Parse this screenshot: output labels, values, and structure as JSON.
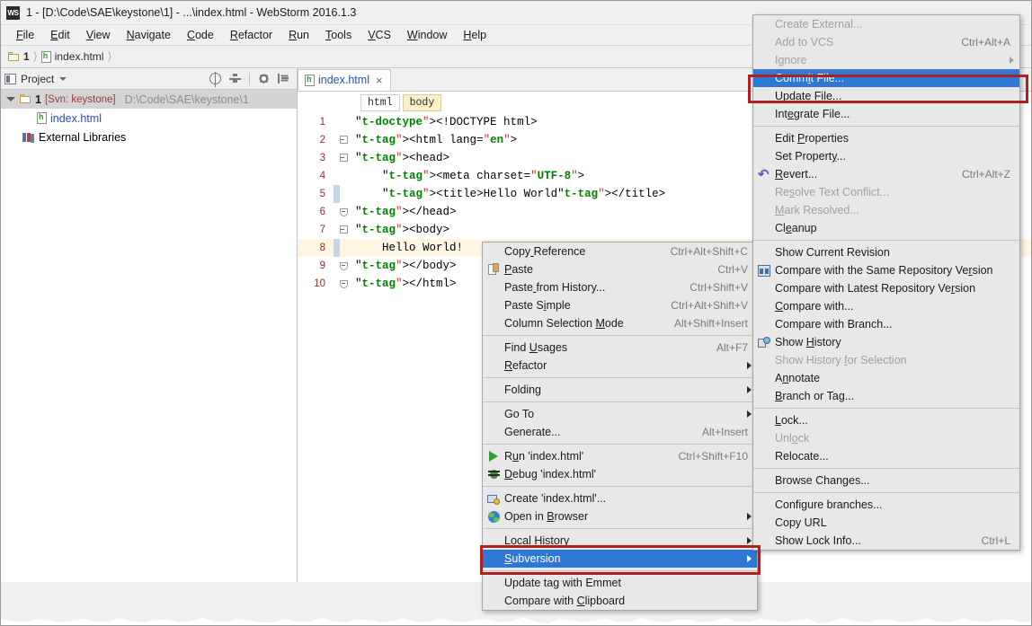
{
  "window": {
    "logo": "WS",
    "title": "1 - [D:\\Code\\SAE\\keystone\\1] - ...\\index.html - WebStorm 2016.1.3"
  },
  "menubar": [
    {
      "label": "File"
    },
    {
      "label": "Edit"
    },
    {
      "label": "View"
    },
    {
      "label": "Navigate"
    },
    {
      "label": "Code"
    },
    {
      "label": "Refactor"
    },
    {
      "label": "Run"
    },
    {
      "label": "Tools"
    },
    {
      "label": "VCS"
    },
    {
      "label": "Window"
    },
    {
      "label": "Help"
    }
  ],
  "breadcrumb": {
    "items": [
      "1",
      "index.html"
    ]
  },
  "project_panel": {
    "title": "Project",
    "tree": [
      {
        "name": "1",
        "svn": "[Svn: keystone]",
        "path": "D:\\Code\\SAE\\keystone\\1"
      },
      {
        "name": "index.html"
      },
      {
        "name": "External Libraries"
      }
    ]
  },
  "editor": {
    "tab": {
      "label": "index.html",
      "close": "×"
    },
    "breadcrumbs": [
      {
        "label": "html",
        "active": false
      },
      {
        "label": "body",
        "active": true
      }
    ],
    "lines": [
      {
        "n": "1",
        "text": "<!DOCTYPE html>"
      },
      {
        "n": "2",
        "text": "<html lang=\"en\">"
      },
      {
        "n": "3",
        "text": "<head>"
      },
      {
        "n": "4",
        "text": "    <meta charset=\"UTF-8\">"
      },
      {
        "n": "5",
        "text": "    <title>Hello World</title>"
      },
      {
        "n": "6",
        "text": "</head>"
      },
      {
        "n": "7",
        "text": "<body>"
      },
      {
        "n": "8",
        "text": "    Hello World!"
      },
      {
        "n": "9",
        "text": "</body>"
      },
      {
        "n": "10",
        "text": "</html>"
      }
    ]
  },
  "context_menu": {
    "items": [
      {
        "label": "Copy Reference",
        "key": "Ctrl+Alt+Shift+C",
        "icon": "",
        "mn": 4
      },
      {
        "label": "Paste",
        "key": "Ctrl+V",
        "icon": "paste-icon",
        "mn": 0
      },
      {
        "label": "Paste from History...",
        "key": "Ctrl+Shift+V",
        "icon": "",
        "mn": 5
      },
      {
        "label": "Paste Simple",
        "key": "Ctrl+Alt+Shift+V",
        "icon": "",
        "mn": 7
      },
      {
        "label": "Column Selection Mode",
        "key": "Alt+Shift+Insert",
        "icon": "",
        "mn": 17
      },
      {
        "sep": true
      },
      {
        "label": "Find Usages",
        "key": "Alt+F7",
        "icon": "",
        "mn": 5
      },
      {
        "label": "Refactor",
        "key": "",
        "icon": "",
        "arrow": true,
        "mn": 0
      },
      {
        "sep": true
      },
      {
        "label": "Folding",
        "key": "",
        "icon": "",
        "arrow": true,
        "mn": -1
      },
      {
        "sep": true
      },
      {
        "label": "Go To",
        "key": "",
        "icon": "",
        "arrow": true,
        "mn": -1
      },
      {
        "label": "Generate...",
        "key": "Alt+Insert",
        "icon": "",
        "mn": -1
      },
      {
        "sep": true
      },
      {
        "label": "Run 'index.html'",
        "key": "Ctrl+Shift+F10",
        "icon": "run-icon",
        "mn": 1
      },
      {
        "label": "Debug 'index.html'",
        "key": "",
        "icon": "debug-icon",
        "mn": 0
      },
      {
        "sep": true
      },
      {
        "label": "Create 'index.html'...",
        "key": "",
        "icon": "create-icon",
        "mn": -1
      },
      {
        "label": "Open in Browser",
        "key": "",
        "icon": "browser-icon",
        "arrow": true,
        "mn": 8
      },
      {
        "sep": true
      },
      {
        "label": "Local History",
        "key": "",
        "icon": "",
        "arrow": true,
        "mn": -1
      },
      {
        "label": "Subversion",
        "key": "",
        "icon": "",
        "arrow": true,
        "selected": true,
        "mn": 0
      },
      {
        "sep": true
      },
      {
        "label": "Update tag with Emmet",
        "key": "",
        "icon": "",
        "mn": -1
      },
      {
        "label": "Compare with Clipboard",
        "key": "",
        "icon": "",
        "mn": 13
      }
    ]
  },
  "subversion_menu": {
    "items": [
      {
        "label": "Create External...",
        "key": "",
        "disabled": true,
        "icon": "",
        "mn": -1
      },
      {
        "label": "Add to VCS",
        "key": "Ctrl+Alt+A",
        "disabled": true,
        "icon": "",
        "mn": -1
      },
      {
        "label": "Ignore",
        "key": "",
        "disabled": true,
        "icon": "",
        "arrow": true,
        "mn": -1
      },
      {
        "label": "Commit File...",
        "key": "",
        "selected": true,
        "icon": "",
        "mn": 4
      },
      {
        "label": "Update File...",
        "key": "",
        "icon": "",
        "mn": 0
      },
      {
        "label": "Integrate File...",
        "key": "",
        "icon": "",
        "mn": 3
      },
      {
        "sep": true
      },
      {
        "label": "Edit Properties",
        "key": "",
        "icon": "",
        "mn": 5
      },
      {
        "label": "Set Property...",
        "key": "",
        "icon": "",
        "mn": 11
      },
      {
        "label": "Revert...",
        "key": "Ctrl+Alt+Z",
        "icon": "revert-icon",
        "mn": 0
      },
      {
        "label": "Resolve Text Conflict...",
        "key": "",
        "disabled": true,
        "icon": "",
        "mn": 2
      },
      {
        "label": "Mark Resolved...",
        "key": "",
        "disabled": true,
        "icon": "",
        "mn": 0
      },
      {
        "label": "Cleanup",
        "key": "",
        "icon": "",
        "mn": 2
      },
      {
        "sep": true
      },
      {
        "label": "Show Current Revision",
        "key": "",
        "icon": "",
        "mn": -1
      },
      {
        "label": "Compare with the Same Repository Version",
        "key": "",
        "icon": "compare-icon",
        "mn": 35
      },
      {
        "label": "Compare with Latest Repository Version",
        "key": "",
        "icon": "",
        "mn": 33
      },
      {
        "label": "Compare with...",
        "key": "",
        "icon": "",
        "mn": 0
      },
      {
        "label": "Compare with Branch...",
        "key": "",
        "icon": "",
        "mn": -1
      },
      {
        "label": "Show History",
        "key": "",
        "icon": "history-icon",
        "mn": 5
      },
      {
        "label": "Show History for Selection",
        "key": "",
        "disabled": true,
        "icon": "",
        "mn": 13
      },
      {
        "label": "Annotate",
        "key": "",
        "icon": "",
        "mn": 1
      },
      {
        "label": "Branch or Tag...",
        "key": "",
        "icon": "",
        "mn": 0
      },
      {
        "sep": true
      },
      {
        "label": "Lock...",
        "key": "",
        "icon": "",
        "mn": 0
      },
      {
        "label": "Unlock",
        "key": "",
        "disabled": true,
        "icon": "",
        "mn": 3
      },
      {
        "label": "Relocate...",
        "key": "",
        "icon": "",
        "mn": -1
      },
      {
        "sep": true
      },
      {
        "label": "Browse Changes...",
        "key": "",
        "icon": "",
        "mn": -1
      },
      {
        "sep": true
      },
      {
        "label": "Configure branches...",
        "key": "",
        "icon": "",
        "mn": -1
      },
      {
        "label": "Copy URL",
        "key": "",
        "icon": "",
        "mn": -1
      },
      {
        "label": "Show Lock Info...",
        "key": "Ctrl+L",
        "icon": "",
        "mn": -1
      }
    ]
  },
  "colors": {
    "selection_blue": "#2f79d4",
    "highlight_red": "#b02020",
    "current_line": "#fcf6e3",
    "line_number": "#8a2f2f",
    "tag": "#000080",
    "attr_value": "#008000",
    "link": "#2a4fb8"
  }
}
